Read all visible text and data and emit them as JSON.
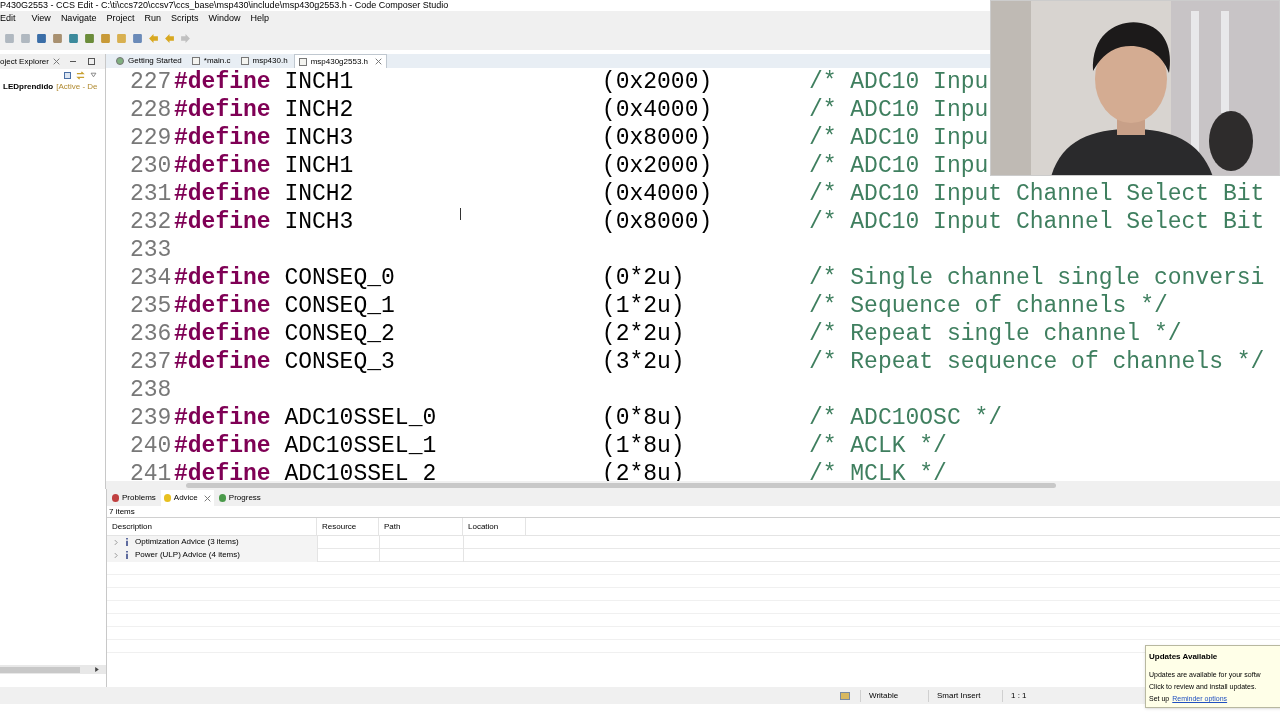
{
  "window": {
    "title": "P430G2553 - CCS Edit - C:\\ti\\ccs720\\ccsv7\\ccs_base\\msp430\\include\\msp430g2553.h - Code Composer Studio"
  },
  "menu": [
    "Edit",
    "View",
    "Navigate",
    "Project",
    "Run",
    "Scripts",
    "Window",
    "Help"
  ],
  "project_explorer": {
    "title": "oject Explorer",
    "project": "LEDprendido",
    "project_status": "[Active - De"
  },
  "editor_tabs": [
    {
      "label": "Getting Started",
      "selected": false,
      "closable": false
    },
    {
      "label": "*main.c",
      "selected": false,
      "closable": false
    },
    {
      "label": "msp430.h",
      "selected": false,
      "closable": false
    },
    {
      "label": "msp430g2553.h",
      "selected": true,
      "closable": true
    }
  ],
  "code_glitch": [
    {
      "line": "227",
      "directive": "#define",
      "name": "INCH1",
      "value": "(0x2000)",
      "comment": "/* ADC10 Inpu"
    },
    {
      "line": "228",
      "directive": "#define",
      "name": "INCH2",
      "value": "(0x4000)",
      "comment": "/* ADC10 Inpu"
    },
    {
      "line": "229",
      "directive": "#define",
      "name": "INCH3",
      "value": "(0x8000)",
      "comment": "/* ADC10 Inpu"
    }
  ],
  "code": [
    {
      "line": "230",
      "directive": "#define",
      "name": "INCH1",
      "value": "(0x2000)",
      "comment": "/* ADC10 Inpu"
    },
    {
      "line": "231",
      "directive": "#define",
      "name": "INCH2",
      "value": "(0x4000)",
      "comment": "/* ADC10 Input Channel Select Bit"
    },
    {
      "line": "232",
      "directive": "#define",
      "name": "INCH3",
      "value": "(0x8000)",
      "comment": "/* ADC10 Input Channel Select Bit"
    },
    {
      "line": "233"
    },
    {
      "line": "234",
      "directive": "#define",
      "name": "CONSEQ_0",
      "value": "(0*2u)",
      "comment": "/* Single channel single conversi"
    },
    {
      "line": "235",
      "directive": "#define",
      "name": "CONSEQ_1",
      "value": "(1*2u)",
      "comment": "/* Sequence of channels */"
    },
    {
      "line": "236",
      "directive": "#define",
      "name": "CONSEQ_2",
      "value": "(2*2u)",
      "comment": "/* Repeat single channel */"
    },
    {
      "line": "237",
      "directive": "#define",
      "name": "CONSEQ_3",
      "value": "(3*2u)",
      "comment": "/* Repeat sequence of channels */"
    },
    {
      "line": "238"
    },
    {
      "line": "239",
      "directive": "#define",
      "name": "ADC10SSEL_0",
      "value": "(0*8u)",
      "comment": "/* ADC10OSC */"
    },
    {
      "line": "240",
      "directive": "#define",
      "name": "ADC10SSEL_1",
      "value": "(1*8u)",
      "comment": "/* ACLK */"
    },
    {
      "line": "241",
      "directive": "#define",
      "name": "ADC10SSEL_2",
      "value": "(2*8u)",
      "comment": "/* MCLK */"
    }
  ],
  "bottom_tabs": [
    {
      "label": "Problems",
      "selected": false
    },
    {
      "label": "Advice",
      "selected": true
    },
    {
      "label": "Progress",
      "selected": false
    }
  ],
  "advice": {
    "count": "7 items",
    "columns": [
      "Description",
      "Resource",
      "Path",
      "Location"
    ],
    "rows": [
      {
        "description": "Optimization Advice (3 items)",
        "expanded": false
      },
      {
        "description": "Power (ULP) Advice (4 items)",
        "expanded": false
      }
    ]
  },
  "status_bar": [
    "Writable",
    "Smart Insert",
    "1 : 1"
  ],
  "notification": {
    "title": "Updates Available",
    "line_1": "Updates are available for your softw",
    "line_2": "Click to review and install updates.",
    "prefix": "Set up",
    "link": "Reminder options"
  },
  "webcam": {
    "kind": "picture"
  }
}
